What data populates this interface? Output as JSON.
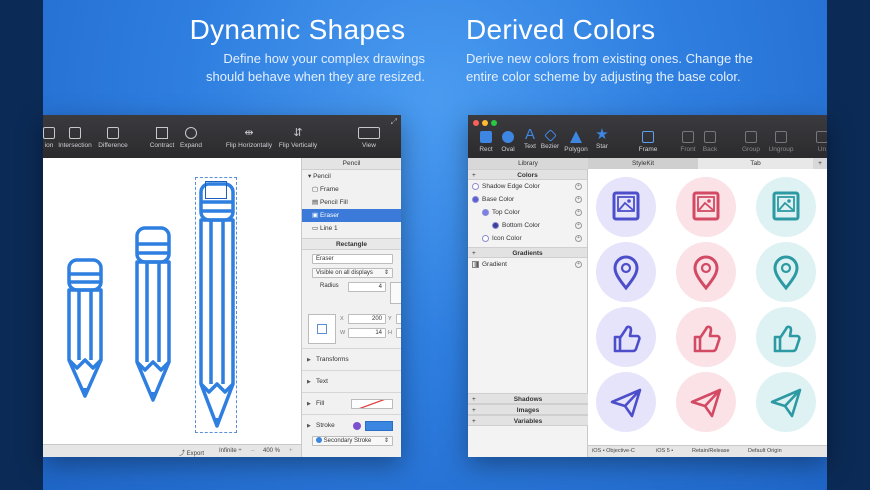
{
  "left_heading": {
    "title": "Dynamic Shapes",
    "desc_line1": "Define how your complex drawings",
    "desc_line2": "should behave when they are resized."
  },
  "right_heading": {
    "title": "Derived Colors",
    "desc_line1": "Derive new colors from existing ones. Change the",
    "desc_line2": "entire color scheme by adjusting the base color."
  },
  "left_window": {
    "toolbar": [
      "ion",
      "Intersection",
      "Difference",
      "Contract",
      "Expand",
      "Flip Horizontally",
      "Flip Vertically",
      "View"
    ],
    "inspector_title": "Pencil",
    "tree": [
      "Pencil",
      "Frame",
      "Pencil Fill",
      "Eraser",
      "Line 1"
    ],
    "rect_section": "Rectangle",
    "name_value": "Eraser",
    "visibility": "Visible on all displays",
    "radius_label": "Radius",
    "radius_value": "4",
    "x_label": "X",
    "x_value": "200",
    "y_label": "Y",
    "y_value": "29",
    "w_label": "W",
    "w_value": "14",
    "h_label": "H",
    "h_value": "12",
    "sections": [
      "Transforms",
      "Text",
      "Fill",
      "Stroke"
    ],
    "stroke_option": "Secondary Stroke",
    "status": {
      "export": "Export",
      "infinite": "Infinite ÷",
      "zoom": "400 %"
    }
  },
  "right_window": {
    "toolbar": [
      "Rect",
      "Oval",
      "Text",
      "Bezier",
      "Polygon",
      "Star",
      "Frame",
      "Front",
      "Back",
      "Group",
      "Ungroup",
      "Un"
    ],
    "tabs": [
      "Library",
      "StyleKit",
      "Tab"
    ],
    "colors_section": "Colors",
    "colors": [
      {
        "label": "Shadow Edge Color",
        "color": "#ffffff",
        "indent": 0
      },
      {
        "label": "Base Color",
        "color": "#5b5fd6",
        "indent": 0
      },
      {
        "label": "Top Color",
        "color": "#7b7fe8",
        "indent": 1
      },
      {
        "label": "Bottom Color",
        "color": "#3c3f9e",
        "indent": 2
      },
      {
        "label": "Icon Color",
        "color": "#ffffff",
        "indent": 1
      }
    ],
    "gradients_section": "Gradients",
    "gradient_item": "Gradient",
    "other_sections": [
      "Shadows",
      "Images",
      "Variables"
    ],
    "icon_columns": [
      {
        "bg": "#e6e4fb",
        "stroke": "#4c4fc9"
      },
      {
        "bg": "#fbe2e7",
        "stroke": "#d24a63"
      },
      {
        "bg": "#def2f3",
        "stroke": "#2d9aa3"
      }
    ],
    "status": [
      "iOS • Objective-C",
      "iOS 5 •",
      "Retain/Release",
      "Default Origin"
    ]
  }
}
